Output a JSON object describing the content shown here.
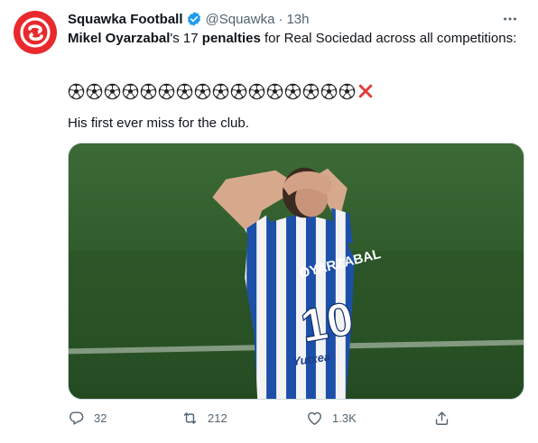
{
  "tweet": {
    "author_name": "Squawka Football",
    "handle": "@Squawka",
    "separator": "·",
    "time": "13h",
    "text_line1_parts": {
      "name": "Mikel Oyarzabal",
      "mid": "'s 17 ",
      "bold": "penalties",
      "rest": " for Real Sociedad across all competitions:"
    },
    "emoji_row": {
      "scored_count": 16,
      "scored_icon": "soccer-ball-icon",
      "missed_icon": "red-cross-icon"
    },
    "text_line2": "His first ever miss for the club.",
    "media": {
      "shirt_name": "OYARZABAL",
      "shirt_number": "10",
      "sponsor": "Yutxea",
      "colors": {
        "pitch": "#2f5c2b",
        "shirt_blue": "#1c4fa8",
        "shirt_white": "#f2f2f2"
      }
    }
  },
  "actions": {
    "reply": {
      "icon": "reply-icon",
      "count": "32"
    },
    "retweet": {
      "icon": "retweet-icon",
      "count": "212"
    },
    "like": {
      "icon": "heart-icon",
      "count": "1.3K"
    },
    "share": {
      "icon": "share-icon",
      "count": ""
    }
  },
  "colors": {
    "brand": "#e8292d",
    "verified": "#1d9bf0",
    "muted": "#536471",
    "text": "#0f1419",
    "cross": "#e03a3a"
  }
}
